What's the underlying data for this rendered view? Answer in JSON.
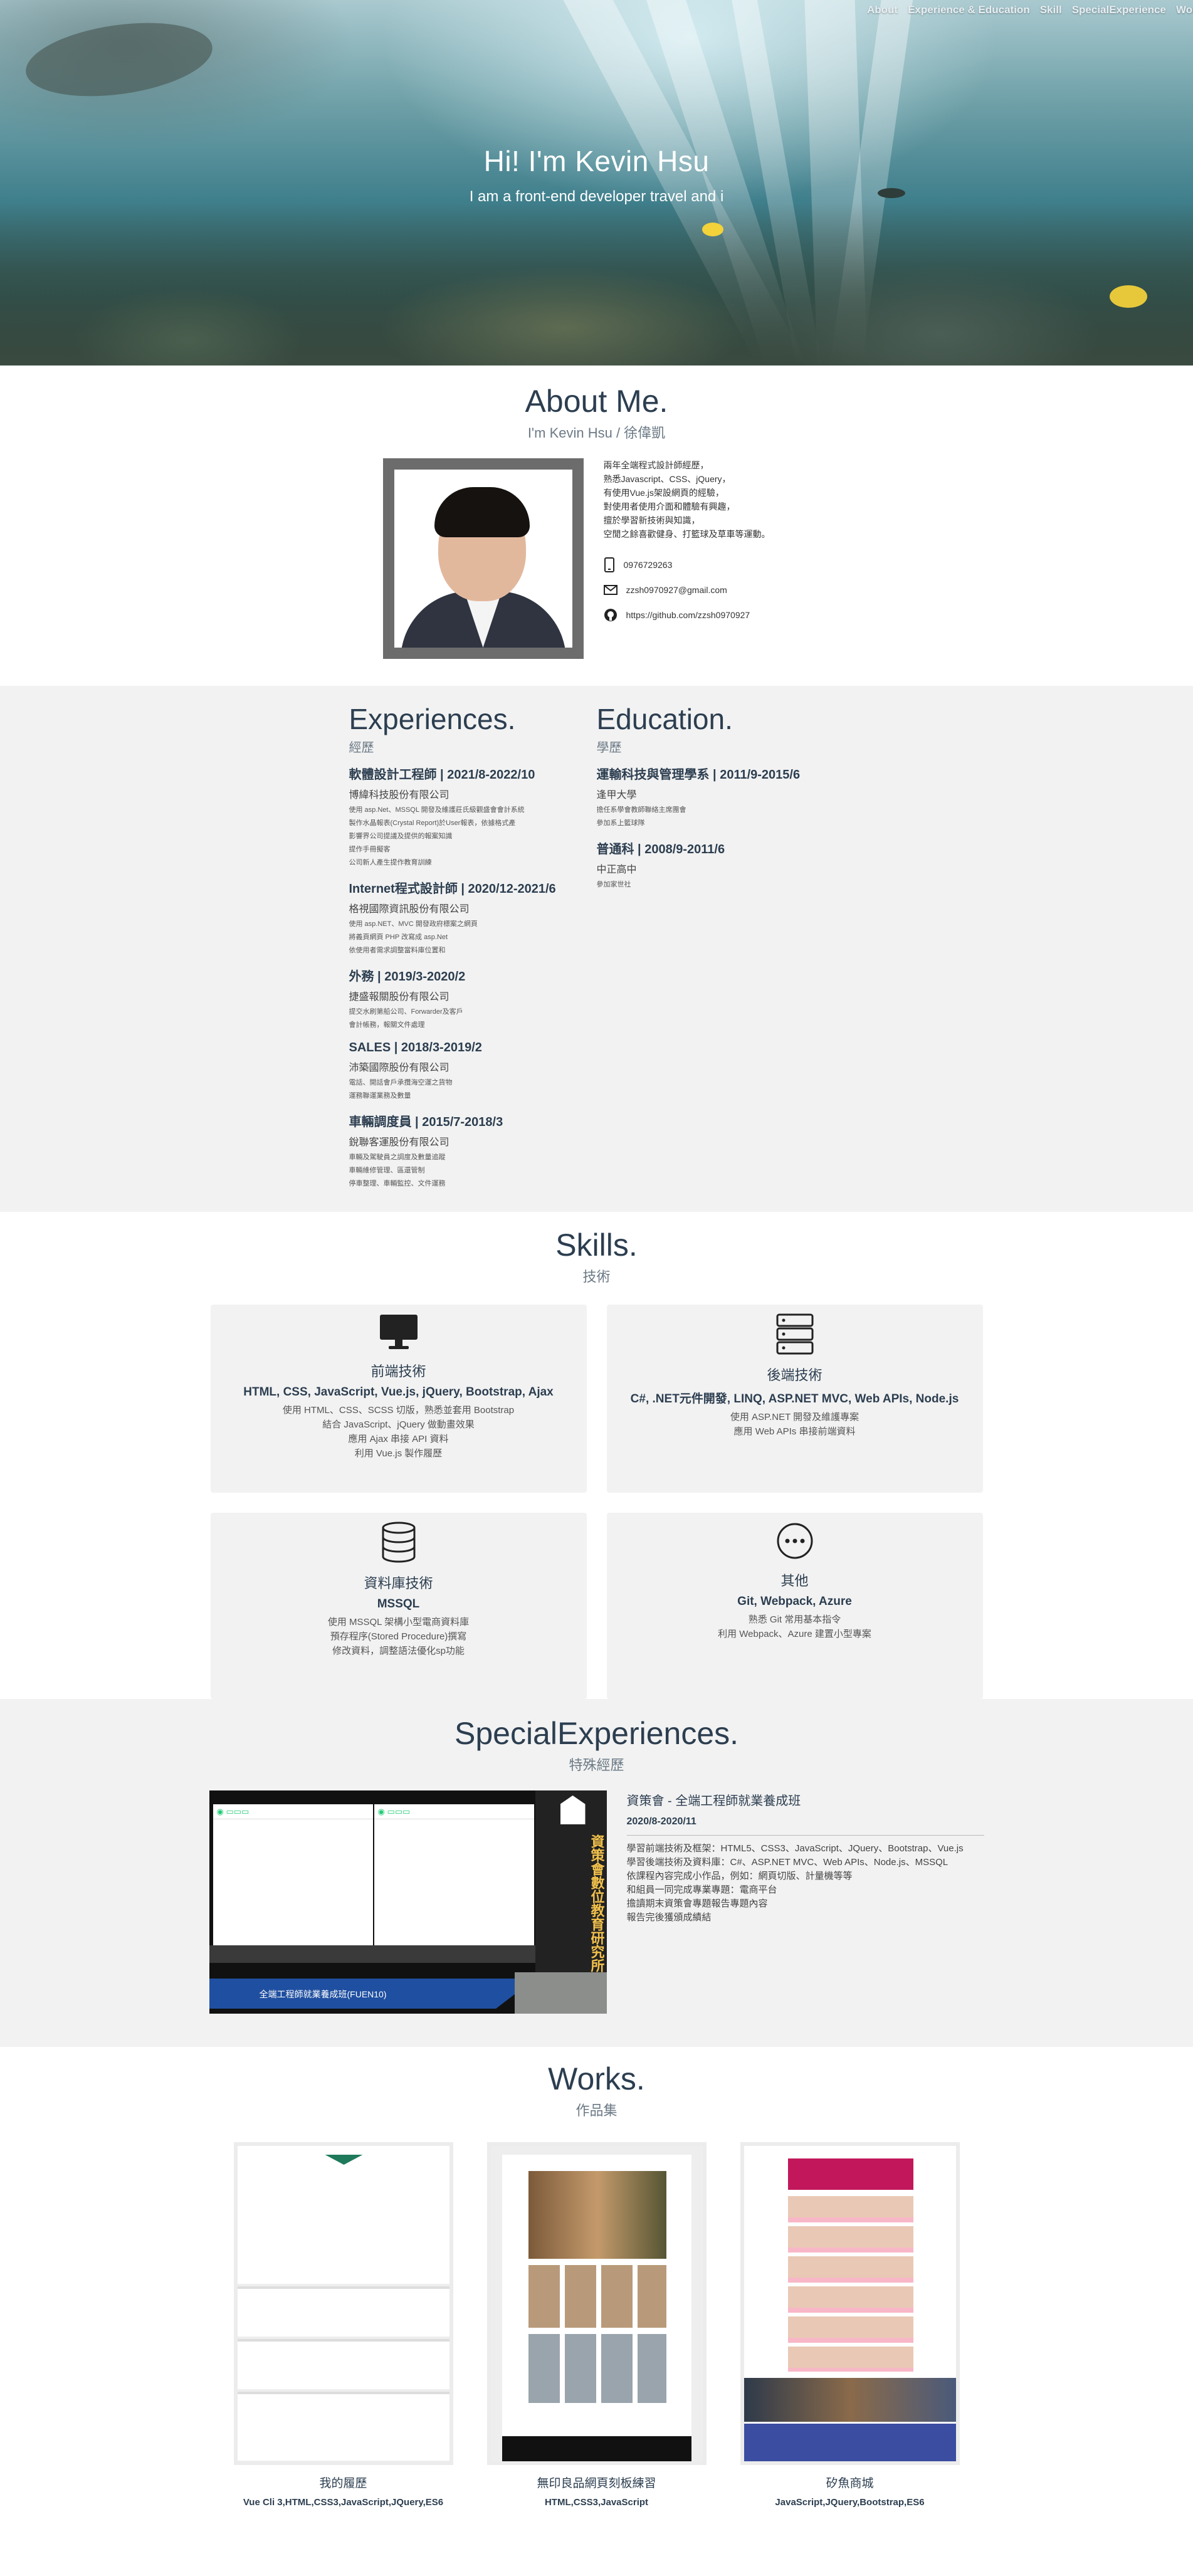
{
  "nav": {
    "items": [
      "About",
      "Experience & Education",
      "Skill",
      "SpecialExperience",
      "Work"
    ]
  },
  "hero": {
    "title": "Hi! I'm Kevin Hsu",
    "subtitle": "I am a front-end developer travel and i"
  },
  "about": {
    "title": "About Me.",
    "subtitle": "I'm Kevin Hsu / 徐偉凱",
    "bio": [
      "兩年全端程式設計師經歷，",
      "熟悉Javascript、CSS、jQuery，",
      "有使用Vue.js架設網頁的經驗，",
      "對使用者使用介面和體驗有興趣，",
      "擅於學習新技術與知識，",
      "空閒之餘喜歡健身、打籃球及草車等運動。"
    ],
    "phone": "0976729263",
    "email": "zzsh0970927@gmail.com",
    "github": "https://github.com/zzsh0970927"
  },
  "experience": {
    "title": "Experiences.",
    "subtitle": "經歷",
    "jobs": [
      {
        "title": "軟體設計工程師 | 2021/8-2022/10",
        "company": "博緯科技股份有限公司",
        "desc": [
          "使用 asp.Net、MSSQL 開發及維護莊氏級觀盛會會計系統",
          "製作水晶報表(Crystal Report)於User報表，依據格式產",
          "影響界公司提議及提供的報案知識",
          "提作手冊擬客",
          "公司新人產生提作教育訓練"
        ]
      },
      {
        "title": "Internet程式設計師 | 2020/12-2021/6",
        "company": "格視國際資訊股份有限公司",
        "desc": [
          "使用 asp.NET、MVC 開發政府標案之網頁",
          "將義頁網頁 PHP 改寫成 asp.Net",
          "依使用者需求調整當料庫位置和"
        ]
      },
      {
        "title": "外務 | 2019/3-2020/2",
        "company": "捷盛報關股份有限公司",
        "desc": [
          "提交水刷第船公司、Forwarder及客戶",
          "會計帳務，報關文件處理"
        ]
      },
      {
        "title": "SALES | 2018/3-2019/2",
        "company": "沛築國際股份有限公司",
        "desc": [
          "電話、開話會戶承攬海空運之貨物",
          "運務聯運業務及數量"
        ]
      },
      {
        "title": "車輛調度員 | 2015/7-2018/3",
        "company": "銳聯客運股份有限公司",
        "desc": [
          "車輛及駕駛員之調度及數量追蹤",
          "車輛維修管理、區還管制",
          "停車整理、車輛監控、文件運務"
        ]
      }
    ]
  },
  "education": {
    "title": "Education.",
    "subtitle": "學歷",
    "schools": [
      {
        "title": "運輸科技與管理學系 | 2011/9-2015/6",
        "school": "逢甲大學",
        "desc": [
          "擔任系學會教師聯絡主席團會",
          "參加系上籃球隊"
        ]
      },
      {
        "title": "普通科 | 2008/9-2011/6",
        "school": "中正高中",
        "desc": [
          "參加家世社"
        ]
      }
    ]
  },
  "skills": {
    "title": "Skills.",
    "subtitle": "技術",
    "cards": [
      {
        "icon": "monitor-icon",
        "title": "前端技術",
        "stack": "HTML, CSS, JavaScript, Vue.js, jQuery, Bootstrap, Ajax",
        "points": [
          "使用 HTML、CSS、SCSS 切版，熟悉並套用 Bootstrap",
          "結合 JavaScript、jQuery 做動畫效果",
          "應用 Ajax 串接 API 資料",
          "利用 Vue.js 製作履歷"
        ]
      },
      {
        "icon": "server-icon",
        "title": "後端技術",
        "stack": "C#, .NET元件開發, LINQ, ASP.NET MVC, Web APIs, Node.js",
        "points": [
          "使用 ASP.NET 開發及維護專案",
          "應用 Web APIs 串接前端資料"
        ]
      },
      {
        "icon": "database-icon",
        "title": "資料庫技術",
        "stack": "MSSQL",
        "points": [
          "使用 MSSQL 架構小型電商資料庫",
          "預存程序(Stored Procedure)撰寫",
          "修改資料，調整語法優化sp功能"
        ]
      },
      {
        "icon": "more-icon",
        "title": "其他",
        "stack": "Git, Webpack, Azure",
        "points": [
          "熟悉 Git 常用基本指令",
          "利用 Webpack、Azure 建置小型專案"
        ]
      }
    ]
  },
  "special": {
    "title": "SpecialExperiences.",
    "subtitle": "特殊經歷",
    "heading": "資策會 - 全端工程師就業養成班",
    "date": "2020/8-2020/11",
    "points": [
      "學習前端技術及框架：HTML5、CSS3、JavaScript、JQuery、Bootstrap、Vue.js",
      "學習後端技術及資料庫：C#、ASP.NET MVC、Web APIs、Node.js、MSSQL",
      "依課程內容完成小作品，例如：網頁切版、計量機等等",
      "和組員一同完成專業專題：電商平台",
      "擔讀期末資策會專題報告專題內容",
      "報告完後獲頒成績結"
    ],
    "image_caption": "全端工程師就業養成班(FUEN10)",
    "banner": "資策會數位教育研究所"
  },
  "works": {
    "title": "Works.",
    "subtitle": "作品集",
    "items": [
      {
        "title": "我的履歷",
        "tech": "Vue Cli 3,HTML,CSS3,JavaScript,JQuery,ES6"
      },
      {
        "title": "無印良品網頁刻板練習",
        "tech": "HTML,CSS3,JavaScript"
      },
      {
        "title": "矽魚商城",
        "tech": "JavaScript,JQuery,Bootstrap,ES6"
      }
    ]
  }
}
